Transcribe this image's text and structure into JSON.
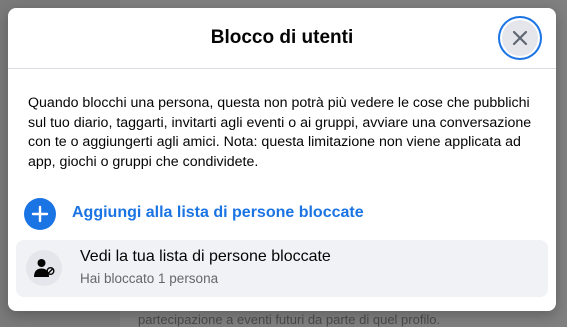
{
  "background": {
    "visible_text": "partecipazione a eventi futuri da parte di quel profilo."
  },
  "dialog": {
    "title": "Blocco di utenti",
    "close_icon": "close-icon",
    "description": "Quando blocchi una persona, questa non potrà più vedere le cose che pubblichi sul tuo diario, taggarti, invitarti agli eventi o ai gruppi, avviare una conversazione con te o aggiungerti agli amici. Nota: questa limitazione non viene applicata ad app, giochi o gruppi che condividete.",
    "add_action": {
      "icon": "plus-icon",
      "label": "Aggiungi alla lista di persone bloccate"
    },
    "block_list": {
      "icon": "user-blocked-icon",
      "title": "Vedi la tua lista di persone bloccate",
      "subtitle": "Hai bloccato 1 persona"
    }
  },
  "colors": {
    "accent": "#1b74e4",
    "row_background": "#f0f2f5",
    "secondary_text": "#65676b"
  }
}
